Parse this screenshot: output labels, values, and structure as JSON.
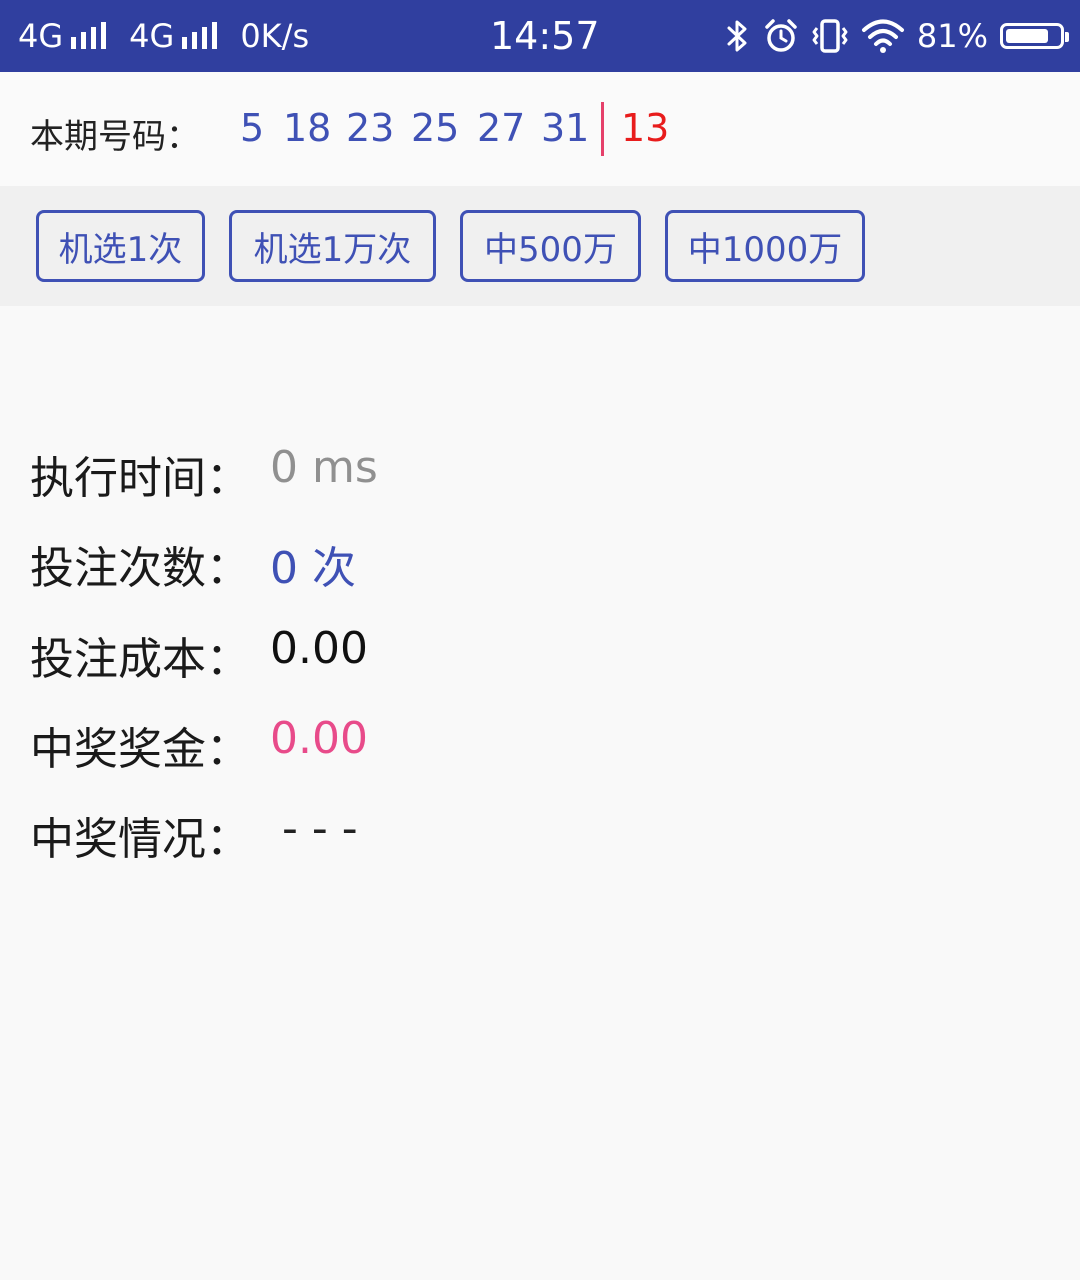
{
  "status_bar": {
    "network1": "4G",
    "network2": "4G",
    "speed": "0K/s",
    "time": "14:57",
    "battery": "81%",
    "battery_level": 0.81,
    "icons": [
      "bluetooth-icon",
      "alarm-icon",
      "vibrate-icon",
      "wifi-icon",
      "battery-icon"
    ]
  },
  "draw": {
    "label": "本期号码：",
    "blue_numbers": [
      "5",
      "18",
      "23",
      "25",
      "27",
      "31"
    ],
    "red_number": "13"
  },
  "buttons": [
    "机选1次",
    "机选1万次",
    "中500万",
    "中1000万"
  ],
  "stats": {
    "time_label": "执行时间：",
    "time_value": "0 ms",
    "count_label": "投注次数：",
    "count_value": "0 次",
    "cost_label": "投注成本：",
    "cost_value": "0.00",
    "prize_label": "中奖奖金：",
    "prize_value": "0.00",
    "status_label": "中奖情况：",
    "status_value": "- - -"
  },
  "colors": {
    "status_bar": "#303f9f",
    "accent": "#3f51b5",
    "red_ball": "#e81c1c",
    "prize": "#e84b8a",
    "muted": "#909090"
  }
}
